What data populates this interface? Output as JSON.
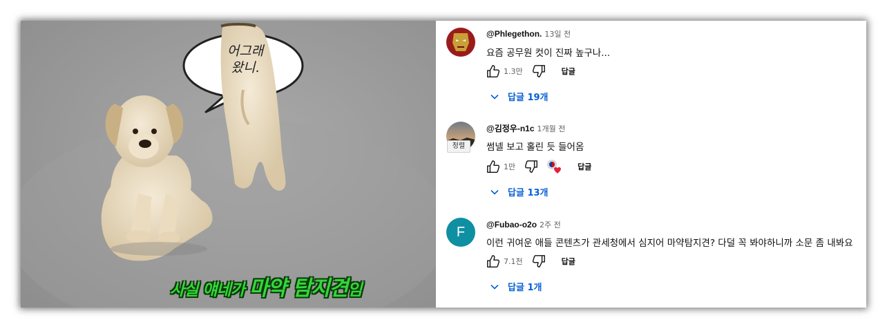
{
  "video": {
    "speech_bubble": {
      "line1": "어그래",
      "line2": "왔니."
    },
    "subtitle": {
      "part1": "사실 얘네가 ",
      "part2": "마약 탐지견",
      "part3": "임"
    }
  },
  "comments": [
    {
      "avatar": "iron-man-avatar",
      "handle": "@Phlegethon.",
      "time": "13일 전",
      "text": "요즘 공무원 컷이 진짜 높구나...",
      "likes": "1.3만",
      "reply_label": "답글",
      "replies_label": "답글 19개"
    },
    {
      "avatar": "sunset-avatar",
      "sort_tag": "정렬",
      "handle": "@김정우-n1c",
      "time": "1개월 전",
      "text": "썸넬 보고 홀린 듯 들어옴",
      "likes": "1만",
      "reply_label": "답글",
      "replies_label": "답글 13개",
      "creator_heart": true
    },
    {
      "avatar_letter": "F",
      "handle": "@Fubao-o2o",
      "time": "2주 전",
      "text": "이런 귀여운 애들 콘텐츠가 관세청에서 심지어 마약탐지견? 다덜 꼭 봐야하니까 소문 좀 내봐요",
      "likes": "7.1천",
      "reply_label": "답글",
      "replies_label": "답글 1개"
    }
  ],
  "colors": {
    "link_blue": "#065fd4",
    "subtitle_green": "#35d63a",
    "avatar_teal": "#0f8fa2"
  }
}
